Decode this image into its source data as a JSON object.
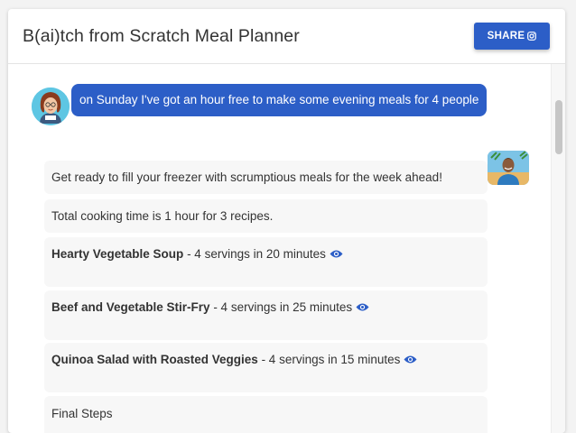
{
  "app": {
    "title": "B(ai)tch from Scratch Meal Planner",
    "share_label": "SHARE",
    "accent_color": "#2c5ec7"
  },
  "conversation": {
    "user_message": "on Sunday I've got an hour free to make some evening meals for 4 people",
    "intro": "Get ready to fill your freezer with scrumptious meals for the week ahead!",
    "total_time": "Total cooking time is 1 hour for 3 recipes.",
    "recipes": [
      {
        "name": "Hearty Vegetable Soup",
        "details": " - 4 servings in 20 minutes",
        "icon": "eye-icon"
      },
      {
        "name": "Beef and Vegetable Stir-Fry",
        "details": " - 4 servings in 25 minutes",
        "icon": "eye-icon"
      },
      {
        "name": "Quinoa Salad with Roasted Veggies",
        "details": " - 4 servings in 15 minutes",
        "icon": "eye-icon"
      }
    ],
    "final_steps": "Final Steps"
  }
}
